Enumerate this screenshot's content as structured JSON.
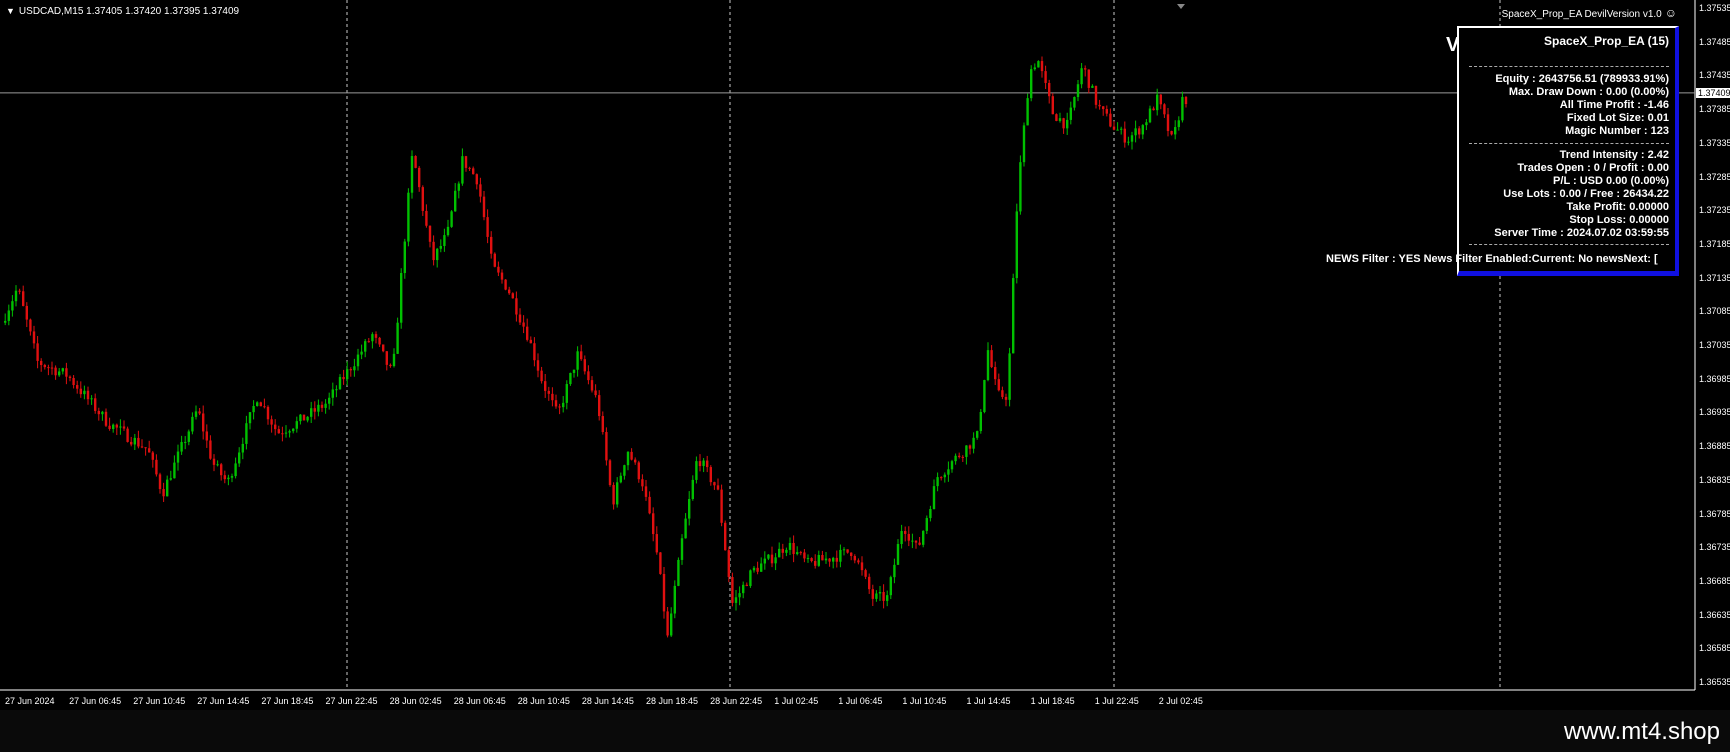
{
  "chart": {
    "symbol_text": "USDCAD,M15  1.37405 1.37420 1.37395 1.37409",
    "ea_header": "SpaceX_Prop_EA DevilVersion v1.0",
    "w_label": "V",
    "current_price": "1.37409",
    "price_min": 1.36535,
    "price_max": 1.37535,
    "price_ticks": [
      "1.37535",
      "1.37485",
      "1.37435",
      "1.37385",
      "1.37335",
      "1.37285",
      "1.37235",
      "1.37185",
      "1.37135",
      "1.37085",
      "1.37035",
      "1.36985",
      "1.36935",
      "1.36885",
      "1.36835",
      "1.36785",
      "1.36735",
      "1.36685",
      "1.36635",
      "1.36585",
      "1.36535"
    ],
    "time_labels": [
      "27 Jun 2024",
      "27 Jun 06:45",
      "27 Jun 10:45",
      "27 Jun 14:45",
      "27 Jun 18:45",
      "27 Jun 22:45",
      "28 Jun 02:45",
      "28 Jun 06:45",
      "28 Jun 10:45",
      "28 Jun 14:45",
      "28 Jun 18:45",
      "28 Jun 22:45",
      "1 Jul 02:45",
      "1 Jul 06:45",
      "1 Jul 10:45",
      "1 Jul 14:45",
      "1 Jul 18:45",
      "1 Jul 22:45",
      "2 Jul 02:45"
    ],
    "colors": {
      "bull": "#00c000",
      "bear": "#e01010",
      "grid": "#c8c8c8",
      "panel_border": "#1010e0"
    }
  },
  "panel": {
    "title": "SpaceX_Prop_EA (15)",
    "group1": [
      "Equity : 2643756.51 (789933.91%)",
      "Max. Draw Down : 0.00 (0.00%)",
      "All Time Profit : -1.46",
      "Fixed Lot Size: 0.01",
      "Magic Number : 123"
    ],
    "group2": [
      "Trend Intensity : 2.42",
      "Trades Open : 0 / Profit : 0.00",
      "P/L : USD 0.00 (0.00%)",
      "Use Lots : 0.00 / Free : 26434.22",
      "Take Profit: 0.00000",
      "Stop Loss: 0.00000",
      "Server Time : 2024.07.02 03:59:55"
    ]
  },
  "news_line": "NEWS Filter : YES News Filter Enabled:Current: No newsNext: [",
  "brand": "www.mt4.shop"
}
